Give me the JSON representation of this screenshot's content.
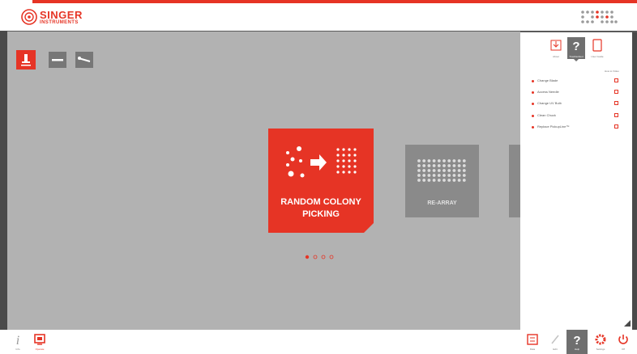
{
  "header": {
    "brand_main": "SINGER",
    "brand_sub": "INSTRUMENTS",
    "brand_color": "#e63425"
  },
  "toolbar": {
    "tools": [
      {
        "icon": "pin-tool-icon",
        "active": true
      },
      {
        "icon": "bar-tool-icon",
        "active": false
      },
      {
        "icon": "wrench-tool-icon",
        "active": false
      }
    ]
  },
  "carousel": {
    "cards": [
      {
        "label": "RANDOM COLONY PICKING",
        "selected": true
      },
      {
        "label": "RE-ARRAY",
        "selected": false
      }
    ],
    "pages_total": 4,
    "page_current": 1
  },
  "panel": {
    "tabs": [
      {
        "label": "About",
        "icon": "download-box-icon"
      },
      {
        "label": "Troubleshoot",
        "icon": "question-mark-icon"
      },
      {
        "label": "User Guide",
        "icon": "tablet-icon"
      }
    ],
    "subheader": "How to Video",
    "items": [
      {
        "label": "Change Blade"
      },
      {
        "label": "Access Needle"
      },
      {
        "label": "Change UV Bulb"
      },
      {
        "label": "Clean Chuck"
      },
      {
        "label": "Replace PickupLine™"
      }
    ]
  },
  "bottom_bar": {
    "left": [
      {
        "label": "Info",
        "icon": "info-icon"
      },
      {
        "label": "Operate",
        "icon": "monitor-icon"
      }
    ],
    "right": [
      {
        "label": "Data",
        "icon": "data-icon"
      },
      {
        "label": "Edit",
        "icon": "pencil-icon"
      },
      {
        "label": "Help",
        "icon": "help-icon"
      },
      {
        "label": "Settings",
        "icon": "gear-icon"
      },
      {
        "label": "Off",
        "icon": "power-icon"
      }
    ]
  }
}
